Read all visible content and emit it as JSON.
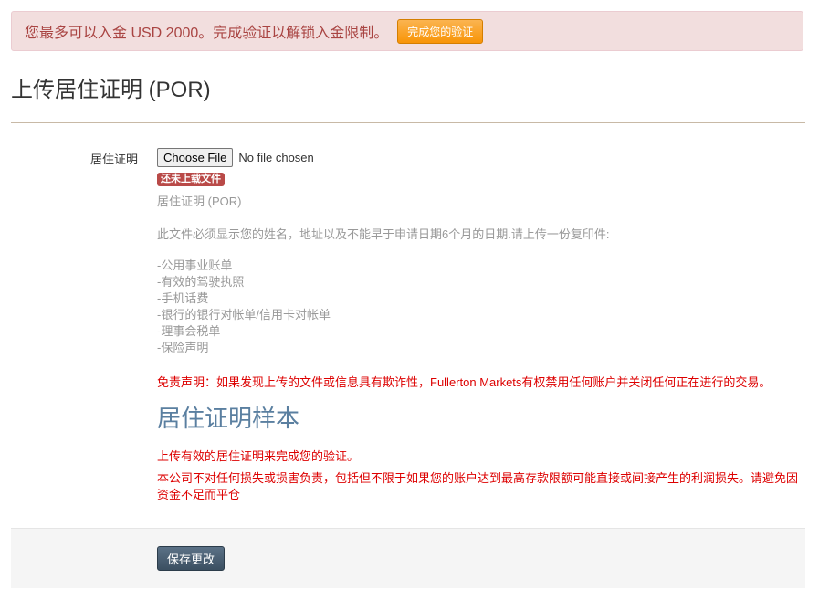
{
  "alert": {
    "text": "您最多可以入金 USD 2000。完成验证以解锁入金限制。",
    "button_label": "完成您的验证"
  },
  "page": {
    "title": "上传居住证明 (POR)"
  },
  "form": {
    "field_label": "居住证明",
    "file_button": "Choose File",
    "file_status": "No file chosen",
    "badge": "还未上载文件",
    "help_title": "居住证明 (POR)",
    "help_text": "此文件必须显示您的姓名，地址以及不能早于申请日期6个月的日期.请上传一份复印件:",
    "documents": [
      "-公用事业账单",
      "-有效的驾驶执照",
      "-手机话费",
      "-银行的银行对帐单/信用卡对帐单",
      "-理事会税单",
      "-保险声明"
    ],
    "disclaimer": "免责声明：如果发现上传的文件或信息具有欺诈性，Fullerton Markets有权禁用任何账户并关闭任何正在进行的交易。",
    "sample_title": "居住证明样本",
    "upload_note": "上传有效的居住证明来完成您的验证。",
    "liability_note": "本公司不对任何损失或损害负责，包括但不限于如果您的账户达到最高存款限额可能直接或间接产生的利润损失。请避免因资金不足而平仓"
  },
  "actions": {
    "save_label": "保存更改"
  }
}
